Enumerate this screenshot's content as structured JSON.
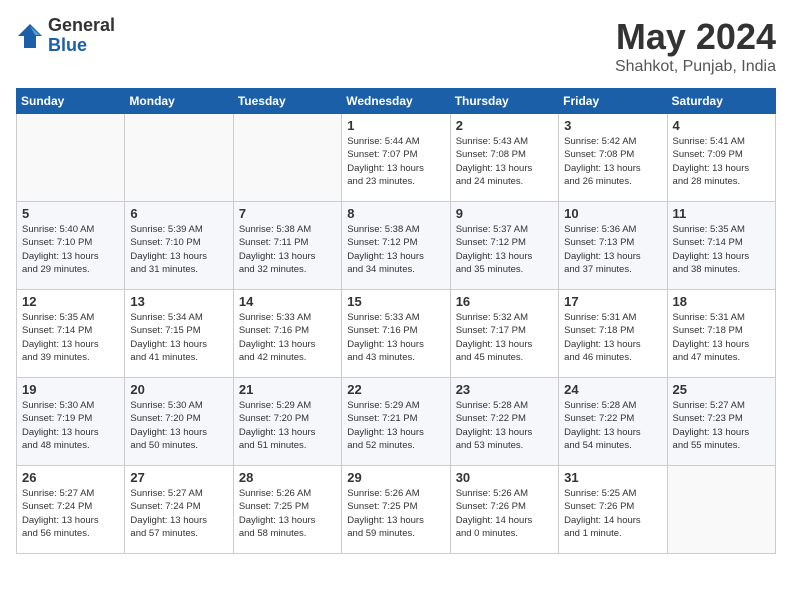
{
  "header": {
    "logo": {
      "general": "General",
      "blue": "Blue"
    },
    "title": "May 2024",
    "location": "Shahkot, Punjab, India"
  },
  "days_of_week": [
    "Sunday",
    "Monday",
    "Tuesday",
    "Wednesday",
    "Thursday",
    "Friday",
    "Saturday"
  ],
  "weeks": [
    [
      {
        "day": "",
        "info": ""
      },
      {
        "day": "",
        "info": ""
      },
      {
        "day": "",
        "info": ""
      },
      {
        "day": "1",
        "info": "Sunrise: 5:44 AM\nSunset: 7:07 PM\nDaylight: 13 hours\nand 23 minutes."
      },
      {
        "day": "2",
        "info": "Sunrise: 5:43 AM\nSunset: 7:08 PM\nDaylight: 13 hours\nand 24 minutes."
      },
      {
        "day": "3",
        "info": "Sunrise: 5:42 AM\nSunset: 7:08 PM\nDaylight: 13 hours\nand 26 minutes."
      },
      {
        "day": "4",
        "info": "Sunrise: 5:41 AM\nSunset: 7:09 PM\nDaylight: 13 hours\nand 28 minutes."
      }
    ],
    [
      {
        "day": "5",
        "info": "Sunrise: 5:40 AM\nSunset: 7:10 PM\nDaylight: 13 hours\nand 29 minutes."
      },
      {
        "day": "6",
        "info": "Sunrise: 5:39 AM\nSunset: 7:10 PM\nDaylight: 13 hours\nand 31 minutes."
      },
      {
        "day": "7",
        "info": "Sunrise: 5:38 AM\nSunset: 7:11 PM\nDaylight: 13 hours\nand 32 minutes."
      },
      {
        "day": "8",
        "info": "Sunrise: 5:38 AM\nSunset: 7:12 PM\nDaylight: 13 hours\nand 34 minutes."
      },
      {
        "day": "9",
        "info": "Sunrise: 5:37 AM\nSunset: 7:12 PM\nDaylight: 13 hours\nand 35 minutes."
      },
      {
        "day": "10",
        "info": "Sunrise: 5:36 AM\nSunset: 7:13 PM\nDaylight: 13 hours\nand 37 minutes."
      },
      {
        "day": "11",
        "info": "Sunrise: 5:35 AM\nSunset: 7:14 PM\nDaylight: 13 hours\nand 38 minutes."
      }
    ],
    [
      {
        "day": "12",
        "info": "Sunrise: 5:35 AM\nSunset: 7:14 PM\nDaylight: 13 hours\nand 39 minutes."
      },
      {
        "day": "13",
        "info": "Sunrise: 5:34 AM\nSunset: 7:15 PM\nDaylight: 13 hours\nand 41 minutes."
      },
      {
        "day": "14",
        "info": "Sunrise: 5:33 AM\nSunset: 7:16 PM\nDaylight: 13 hours\nand 42 minutes."
      },
      {
        "day": "15",
        "info": "Sunrise: 5:33 AM\nSunset: 7:16 PM\nDaylight: 13 hours\nand 43 minutes."
      },
      {
        "day": "16",
        "info": "Sunrise: 5:32 AM\nSunset: 7:17 PM\nDaylight: 13 hours\nand 45 minutes."
      },
      {
        "day": "17",
        "info": "Sunrise: 5:31 AM\nSunset: 7:18 PM\nDaylight: 13 hours\nand 46 minutes."
      },
      {
        "day": "18",
        "info": "Sunrise: 5:31 AM\nSunset: 7:18 PM\nDaylight: 13 hours\nand 47 minutes."
      }
    ],
    [
      {
        "day": "19",
        "info": "Sunrise: 5:30 AM\nSunset: 7:19 PM\nDaylight: 13 hours\nand 48 minutes."
      },
      {
        "day": "20",
        "info": "Sunrise: 5:30 AM\nSunset: 7:20 PM\nDaylight: 13 hours\nand 50 minutes."
      },
      {
        "day": "21",
        "info": "Sunrise: 5:29 AM\nSunset: 7:20 PM\nDaylight: 13 hours\nand 51 minutes."
      },
      {
        "day": "22",
        "info": "Sunrise: 5:29 AM\nSunset: 7:21 PM\nDaylight: 13 hours\nand 52 minutes."
      },
      {
        "day": "23",
        "info": "Sunrise: 5:28 AM\nSunset: 7:22 PM\nDaylight: 13 hours\nand 53 minutes."
      },
      {
        "day": "24",
        "info": "Sunrise: 5:28 AM\nSunset: 7:22 PM\nDaylight: 13 hours\nand 54 minutes."
      },
      {
        "day": "25",
        "info": "Sunrise: 5:27 AM\nSunset: 7:23 PM\nDaylight: 13 hours\nand 55 minutes."
      }
    ],
    [
      {
        "day": "26",
        "info": "Sunrise: 5:27 AM\nSunset: 7:24 PM\nDaylight: 13 hours\nand 56 minutes."
      },
      {
        "day": "27",
        "info": "Sunrise: 5:27 AM\nSunset: 7:24 PM\nDaylight: 13 hours\nand 57 minutes."
      },
      {
        "day": "28",
        "info": "Sunrise: 5:26 AM\nSunset: 7:25 PM\nDaylight: 13 hours\nand 58 minutes."
      },
      {
        "day": "29",
        "info": "Sunrise: 5:26 AM\nSunset: 7:25 PM\nDaylight: 13 hours\nand 59 minutes."
      },
      {
        "day": "30",
        "info": "Sunrise: 5:26 AM\nSunset: 7:26 PM\nDaylight: 14 hours\nand 0 minutes."
      },
      {
        "day": "31",
        "info": "Sunrise: 5:25 AM\nSunset: 7:26 PM\nDaylight: 14 hours\nand 1 minute."
      },
      {
        "day": "",
        "info": ""
      }
    ]
  ]
}
